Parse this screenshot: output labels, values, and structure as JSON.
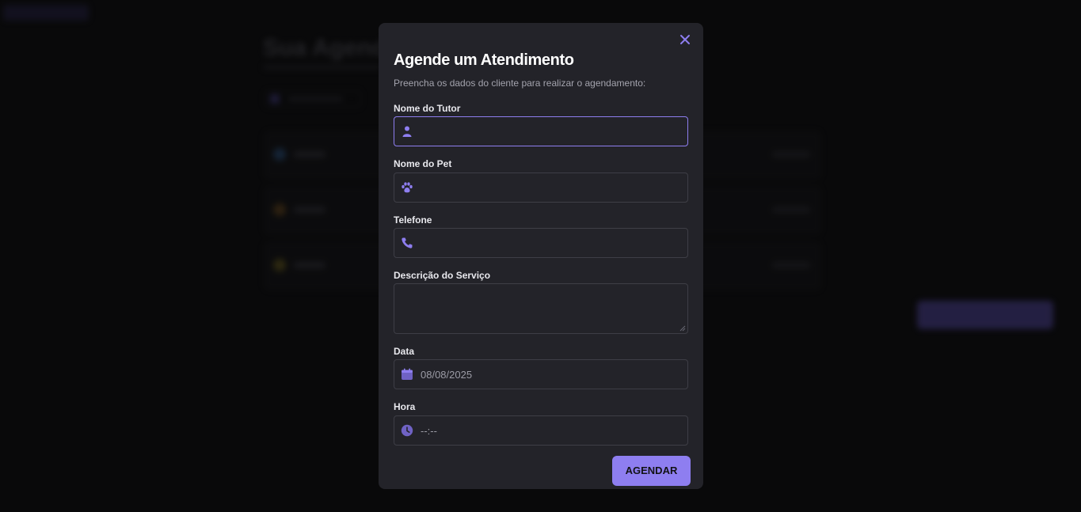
{
  "modal": {
    "title": "Agende um Atendimento",
    "description": "Preencha os dados do cliente para realizar o agendamento:",
    "fields": {
      "tutor": {
        "label": "Nome do Tutor",
        "value": ""
      },
      "pet": {
        "label": "Nome do Pet",
        "value": ""
      },
      "phone": {
        "label": "Telefone",
        "value": ""
      },
      "service": {
        "label": "Descrição do Serviço",
        "value": ""
      },
      "date": {
        "label": "Data",
        "value": "08/08/2025"
      },
      "time": {
        "label": "Hora",
        "value": "--:--"
      }
    },
    "submit_label": "AGENDAR"
  },
  "colors": {
    "accent": "#8e7ef0",
    "modal_bg": "#232329",
    "page_bg": "#09090a"
  },
  "icons": [
    "close-icon",
    "user-icon",
    "paw-icon",
    "phone-icon",
    "calendar-icon",
    "clock-icon"
  ]
}
